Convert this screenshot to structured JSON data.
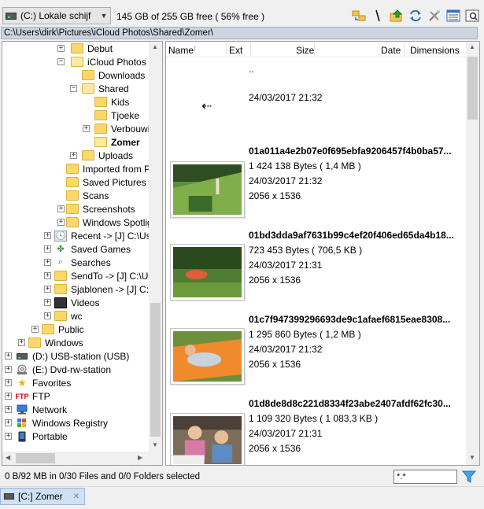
{
  "toolbar": {
    "drive_label": "(C:) Lokale schijf",
    "free_space": "145 GB of 255 GB free ( 56% free )",
    "icons": [
      "sync-folders-icon",
      "separator-icon",
      "up-folder-icon",
      "refresh-icon",
      "tools-icon",
      "view-details-icon",
      "preview-icon"
    ]
  },
  "path": "C:\\Users\\dirk\\Pictures\\iCloud Photos\\Shared\\Zomer\\",
  "tree": {
    "items": [
      {
        "label": "Debut"
      },
      {
        "label": "iCloud Photos"
      },
      {
        "label": "Downloads"
      },
      {
        "label": "Shared"
      },
      {
        "label": "Kids"
      },
      {
        "label": "Tjoeke"
      },
      {
        "label": "Verbouwin"
      },
      {
        "label": "Zomer"
      },
      {
        "label": "Uploads"
      },
      {
        "label": "Imported from Pho"
      },
      {
        "label": "Saved Pictures"
      },
      {
        "label": "Scans"
      },
      {
        "label": "Screenshots"
      },
      {
        "label": "Windows Spotligh"
      },
      {
        "label": "Recent ->  [J] C:\\Use"
      },
      {
        "label": "Saved Games"
      },
      {
        "label": "Searches"
      },
      {
        "label": "SendTo ->  [J] C:\\Us"
      },
      {
        "label": "Sjablonen ->  [J] C:\\U"
      },
      {
        "label": "Videos"
      },
      {
        "label": "wc"
      },
      {
        "label": "Public"
      },
      {
        "label": "Windows"
      },
      {
        "label": "(D:) USB-station (USB)"
      },
      {
        "label": "(E:) Dvd-rw-station"
      },
      {
        "label": "Favorites"
      },
      {
        "label": "FTP"
      },
      {
        "label": "Network"
      },
      {
        "label": "Windows Registry"
      },
      {
        "label": "Portable"
      }
    ]
  },
  "list": {
    "columns": {
      "name": "Name",
      "ext": "Ext",
      "size": "Size",
      "date": "Date",
      "dimensions": "Dimensions"
    },
    "parent": {
      "name": "..",
      "date": "24/03/2017 21:32"
    },
    "files": [
      {
        "name": "01a011a4e2b07e0f695ebfa9206457f4b0ba57...",
        "size": "1 424 138 Bytes ( 1,4 MB )",
        "date": "24/03/2017 21:32",
        "dimensions": "2056 x 1536"
      },
      {
        "name": "01bd3dda9af7631b99c4ef20f406ed65da4b18...",
        "size": "723 453 Bytes ( 706,5 KB )",
        "date": "24/03/2017 21:31",
        "dimensions": "2056 x 1536"
      },
      {
        "name": "01c7f947399296693de9c1afaef6815eae8308...",
        "size": "1 295 860 Bytes ( 1,2 MB )",
        "date": "24/03/2017 21:32",
        "dimensions": "2056 x 1536"
      },
      {
        "name": "01d8de8d8c221d8334f23abe2407afdf62fc30...",
        "size": "1 109 320 Bytes ( 1 083,3 KB )",
        "date": "24/03/2017 21:31",
        "dimensions": "2056 x 1536"
      }
    ]
  },
  "status": {
    "text": "0 B/92 MB in 0/30 Files and 0/0 Folders selected",
    "filter_value": "*.*"
  },
  "tabs": [
    {
      "label": "[C:] Zomer"
    }
  ]
}
